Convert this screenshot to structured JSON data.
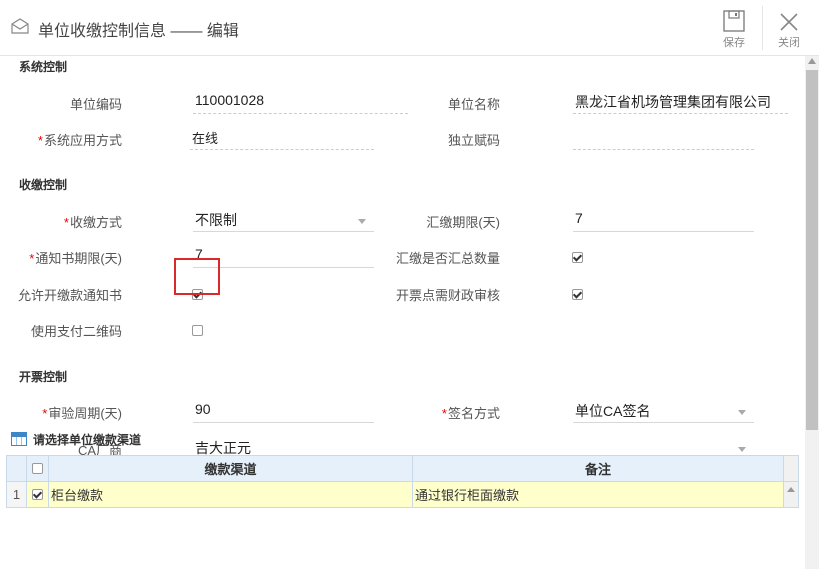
{
  "header": {
    "title": "单位收缴控制信息 —— 编辑",
    "save_label": "保存",
    "close_label": "关闭"
  },
  "sections": {
    "system": "系统控制",
    "collect": "收缴控制",
    "invoice": "开票控制"
  },
  "fields": {
    "unit_code_label": "单位编码",
    "unit_code_value": "110001028",
    "unit_name_label": "单位名称",
    "unit_name_value": "黑龙江省机场管理集团有限公司",
    "sys_mode_label": "系统应用方式",
    "sys_mode_value": "在线",
    "standalone_label": "独立赋码",
    "standalone_value": "",
    "collect_mode_label": "收缴方式",
    "collect_mode_value": "不限制",
    "remit_limit_label": "汇缴期限(天)",
    "remit_limit_value": "7",
    "notice_limit_label": "通知书期限(天)",
    "notice_limit_value": "7",
    "remit_sum_label": "汇缴是否汇总数量",
    "remit_sum_checked": true,
    "allow_notice_label": "允许开缴款通知书",
    "allow_notice_checked": true,
    "invoice_audit_label": "开票点需财政审核",
    "invoice_audit_checked": true,
    "qrcode_label": "使用支付二维码",
    "qrcode_checked": false,
    "audit_cycle_label": "审验周期(天)",
    "audit_cycle_value": "90",
    "sign_mode_label": "签名方式",
    "sign_mode_value": "单位CA签名",
    "ca_vendor_label": "CA厂商",
    "ca_vendor_value": "吉大正元"
  },
  "grid": {
    "title": "请选择单位缴款渠道",
    "columns": [
      "缴款渠道",
      "备注"
    ],
    "rows": [
      {
        "num": "1",
        "checked": true,
        "channel": "柜台缴款",
        "note": "通过银行柜面缴款"
      }
    ]
  }
}
